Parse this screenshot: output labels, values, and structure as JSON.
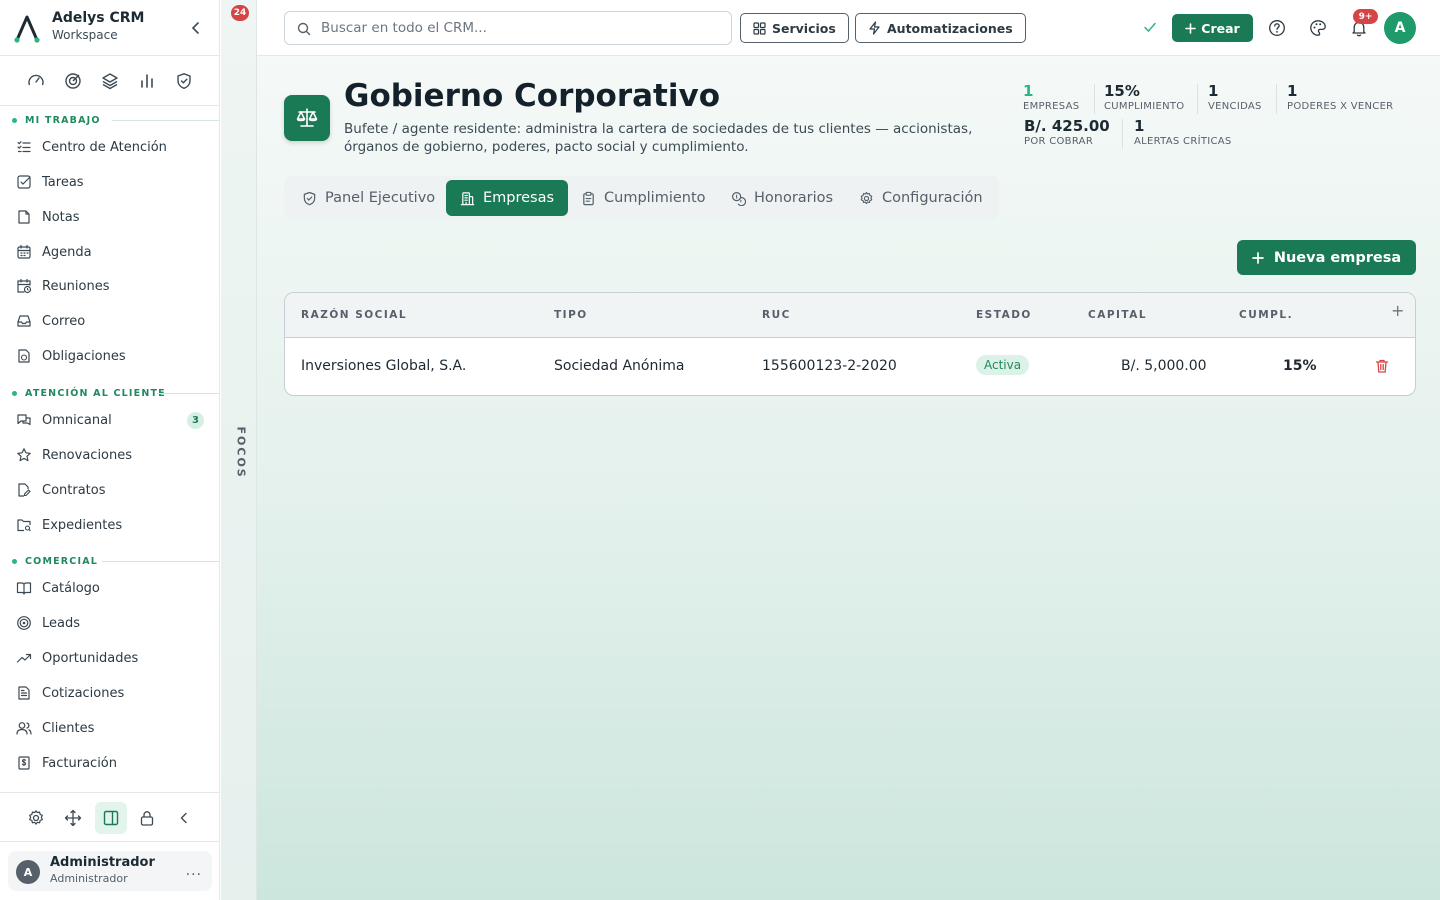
{
  "brand": {
    "name": "Adelys CRM",
    "subtitle": "Workspace"
  },
  "sections": [
    {
      "title": "MI TRABAJO"
    },
    {
      "title": "ATENCIÓN AL CLIENTE"
    },
    {
      "title": "COMERCIAL"
    }
  ],
  "nav": {
    "mi_trabajo": [
      "Centro de Atención",
      "Tareas",
      "Notas",
      "Agenda",
      "Reuniones",
      "Correo",
      "Obligaciones"
    ],
    "atencion": [
      "Omnicanal",
      "Renovaciones",
      "Contratos",
      "Expedientes"
    ],
    "comercial": [
      "Catálogo",
      "Leads",
      "Oportunidades",
      "Cotizaciones",
      "Clientes",
      "Facturación"
    ],
    "omnicanal_badge": "3"
  },
  "user": {
    "initial": "A",
    "name": "Administrador",
    "role": "Administrador",
    "more": "..."
  },
  "focos": {
    "label": "FOCOS",
    "badge": "24"
  },
  "topbar": {
    "search_placeholder": "Buscar en todo el CRM...",
    "servicios": "Servicios",
    "automatizaciones": "Automatizaciones",
    "crear": "Crear",
    "notif_badge": "9+",
    "avatar": "A"
  },
  "header": {
    "title": "Gobierno Corporativo",
    "description": "Bufete / agente residente: administra la cartera de sociedades de tus clientes — accionistas, órganos de gobierno, poderes, pacto social y cumplimiento."
  },
  "kpis": [
    {
      "value": "1",
      "label": "EMPRESAS"
    },
    {
      "value": "15%",
      "label": "CUMPLIMIENTO"
    },
    {
      "value": "1",
      "label": "VENCIDAS"
    },
    {
      "value": "1",
      "label": "PODERES X VENCER"
    },
    {
      "value": "B/. 425.00",
      "label": "POR COBRAR"
    },
    {
      "value": "1",
      "label": "ALERTAS CRÍTICAS"
    }
  ],
  "tabs": [
    "Panel Ejecutivo",
    "Empresas",
    "Cumplimiento",
    "Honorarios",
    "Configuración"
  ],
  "actions": {
    "new_company": "Nueva empresa"
  },
  "table": {
    "columns": [
      "RAZÓN SOCIAL",
      "TIPO",
      "RUC",
      "ESTADO",
      "CAPITAL",
      "CUMPL."
    ],
    "add_column": "+",
    "rows": [
      {
        "name": "Inversiones Global, S.A.",
        "type": "Sociedad Anónima",
        "ruc": "155600123-2-2020",
        "status": "Activa",
        "capital": "B/. 5,000.00",
        "compliance": "15%"
      }
    ]
  },
  "colors": {
    "accent": "#1a7a55",
    "accent_light": "#2bb57f",
    "danger": "#d64545"
  }
}
